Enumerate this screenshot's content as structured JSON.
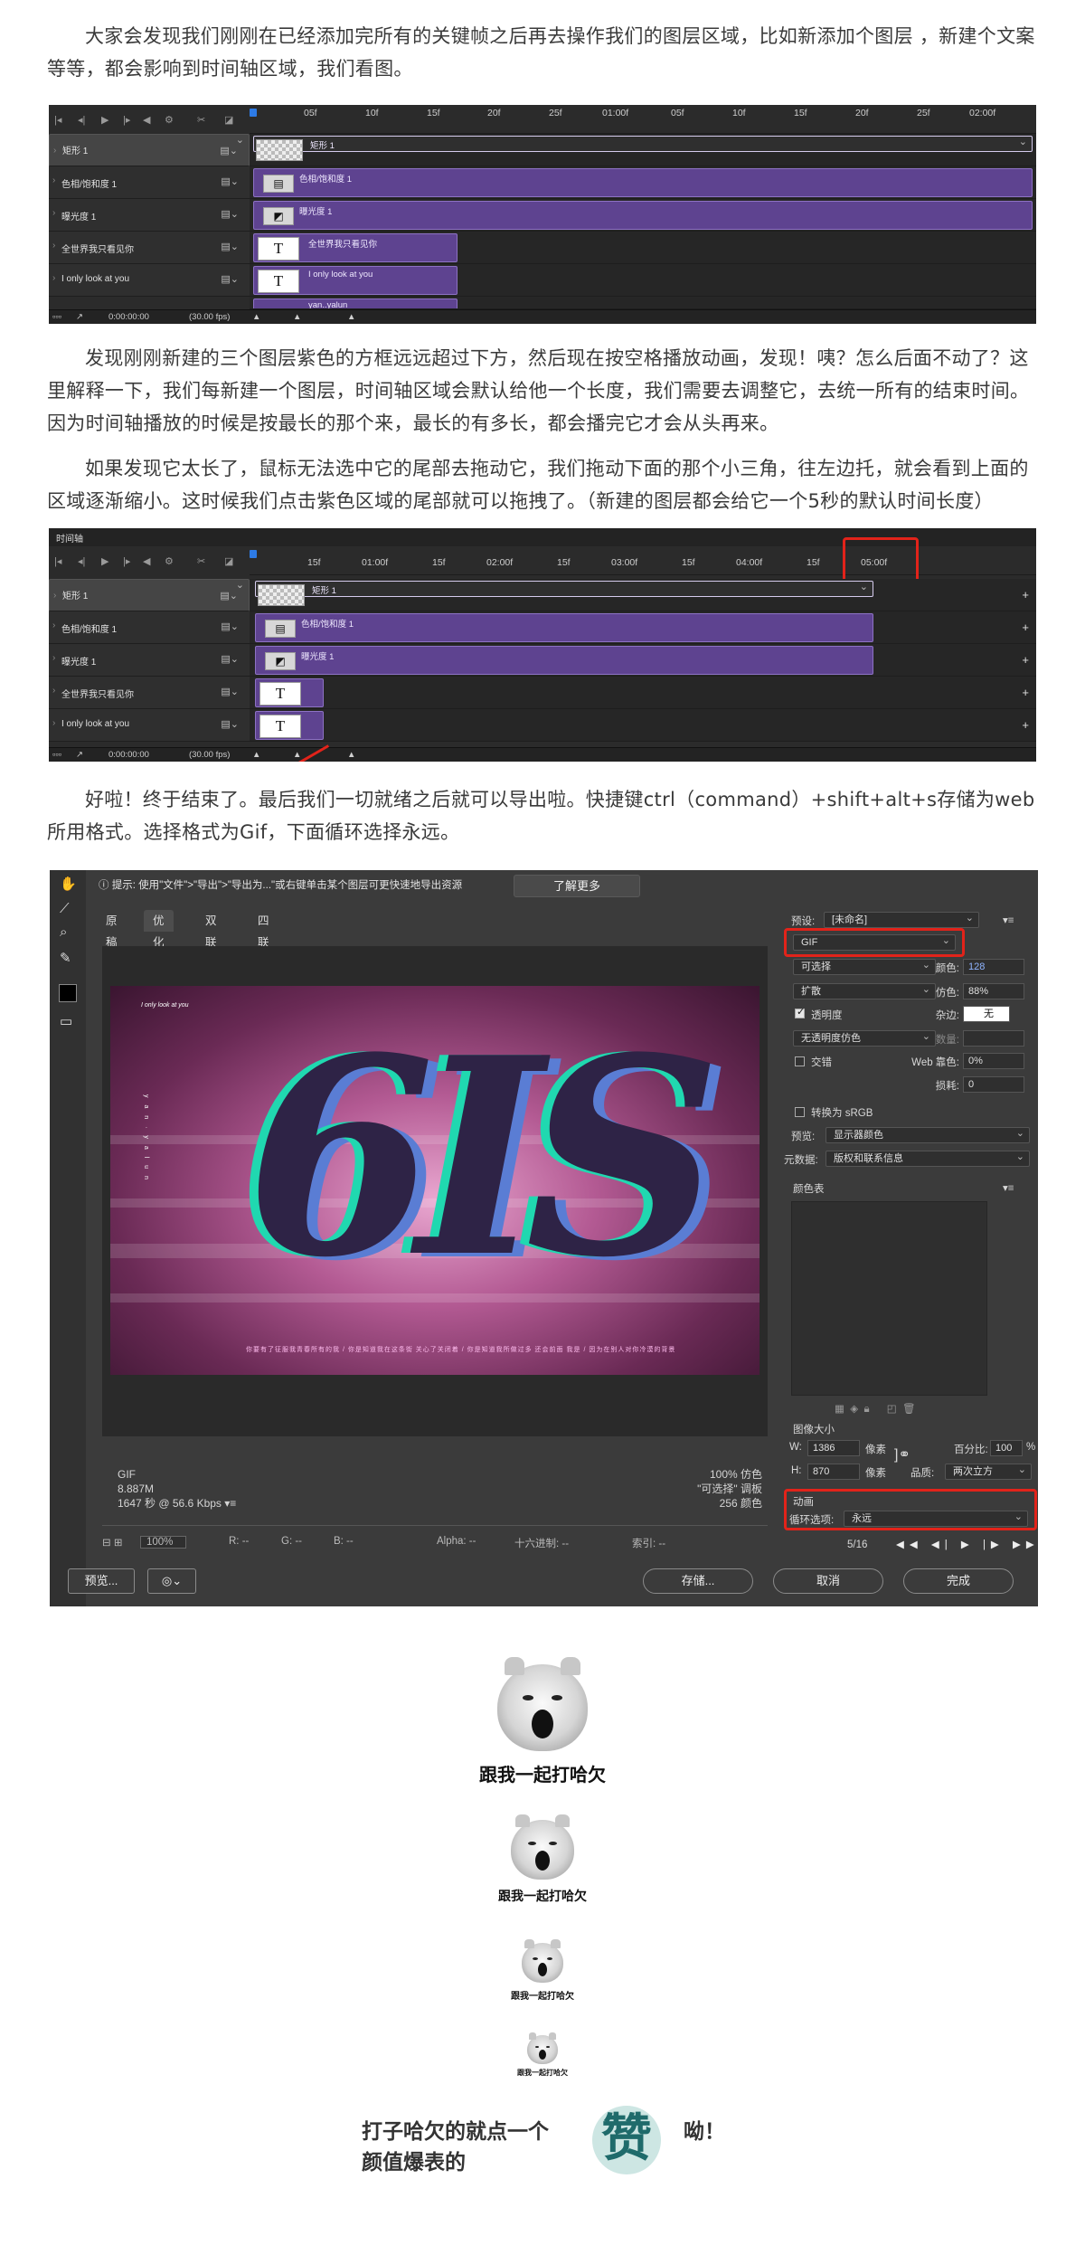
{
  "paragraphs": {
    "p1": "大家会发现我们刚刚在已经添加完所有的关键帧之后再去操作我们的图层区域，比如新添加个图层 ，新建个文案等等，都会影响到时间轴区域，我们看图。",
    "p2": "发现刚刚新建的三个图层紫色的方框远远超过下方，然后现在按空格播放动画，发现！咦？怎么后面不动了？这里解释一下，我们每新建一个图层，时间轴区域会默认给他一个长度，我们需要去调整它，去统一所有的结束时间。因为时间轴播放的时候是按最长的那个来，最长的有多长，都会播完它才会从头再来。",
    "p3": "如果发现它太长了，鼠标无法选中它的尾部去拖动它，我们拖动下面的那个小三角，往左边托，就会看到上面的区域逐渐缩小。这时候我们点击紫色区域的尾部就可以拖拽了。（新建的图层都会给它一个5秒的默认时间长度）",
    "p4": "好啦！终于结束了。最后我们一切就绪之后就可以导出啦。快捷键ctrl（command）+shift+alt+s存储为web所用格式。选择格式为Gif，下面循环选择永远。"
  },
  "timeline1": {
    "ticks": [
      "05f",
      "10f",
      "15f",
      "20f",
      "25f",
      "01:00f",
      "05f",
      "10f",
      "15f",
      "20f",
      "25f",
      "02:00f"
    ],
    "layers": [
      {
        "name": "矩形 1",
        "bar_label": "矩形 1"
      },
      {
        "name": "色相/饱和度 1",
        "bar_label": "色相/饱和度 1"
      },
      {
        "name": "曝光度 1",
        "bar_label": "曝光度 1"
      },
      {
        "name": "全世界我只看见你",
        "bar_label": "全世界我只看见你",
        "thumb": "T"
      },
      {
        "name": "I only look at you",
        "bar_label": "I only look at you",
        "thumb": "T"
      }
    ],
    "extra_bar_label": "yan..yalun",
    "timecode": "0:00:00:00",
    "fps": "(30.00 fps)"
  },
  "timeline2": {
    "panel_title": "时间轴",
    "ticks": [
      "15f",
      "01:00f",
      "15f",
      "02:00f",
      "15f",
      "03:00f",
      "15f",
      "04:00f",
      "15f",
      "05:00f"
    ],
    "layers": [
      {
        "name": "矩形 1",
        "bar_label": "矩形 1"
      },
      {
        "name": "色相/饱和度 1",
        "bar_label": "色相/饱和度 1"
      },
      {
        "name": "曝光度 1",
        "bar_label": "曝光度 1"
      },
      {
        "name": "全世界我只看见你",
        "thumb": "T"
      },
      {
        "name": "I only look at you",
        "thumb": "T"
      }
    ],
    "timecode": "0:00:00:00",
    "fps": "(30.00 fps)"
  },
  "dialog": {
    "tip": "提示: 使用\"文件\">\"导出\">\"导出为...\"或右键单击某个图层可更快速地导出资源",
    "learn_more": "了解更多",
    "tabs": [
      "原稿",
      "优化",
      "双联",
      "四联"
    ],
    "art_small_text": "I only look at you",
    "art_vertical_text": "y a n · y a l u n",
    "art_caption": "你要有了征服我青春所有的我 / 你是知道我在这条街 关心了关闭着 / 你是知道我所做过多 还会前面 我是 / 因为在别人对你冷漠的背景",
    "art_glyph": "6IS",
    "info_left": [
      "GIF",
      "8.887M",
      "1647 秒 @ 56.6 Kbps"
    ],
    "info_right": [
      "100% 仿色",
      "\"可选择\" 调板",
      "256 颜色"
    ],
    "status": {
      "zoom": "100%",
      "r": "R: --",
      "g": "G: --",
      "b": "B: --",
      "alpha": "Alpha: --",
      "hex": "十六进制: --",
      "index": "索引: --"
    },
    "buttons": {
      "preview": "预览...",
      "save": "存储...",
      "cancel": "取消",
      "done": "完成"
    },
    "panel": {
      "preset_label": "预设:",
      "preset_value": "[未命名]",
      "format": "GIF",
      "reduction": "可选择",
      "colors_label": "颜色:",
      "colors_value": "128",
      "dither_algo": "扩散",
      "dither_label": "仿色:",
      "dither_value": "88%",
      "transparency": "透明度",
      "matte_label": "杂边:",
      "matte_value": "无",
      "trans_dither": "无透明度仿色",
      "amount_label": "数量:",
      "interlaced": "交错",
      "web_snap_label": "Web 靠色:",
      "web_snap_value": "0%",
      "lossy_label": "损耗:",
      "lossy_value": "0",
      "srgb": "转换为 sRGB",
      "preview_label": "预览:",
      "preview_value": "显示器颜色",
      "metadata_label": "元数据:",
      "metadata_value": "版权和联系信息",
      "color_table": "颜色表",
      "image_size": "图像大小",
      "w_label": "W:",
      "w_value": "1386",
      "h_label": "H:",
      "h_value": "870",
      "unit": "像素",
      "percent_label": "百分比:",
      "percent_value": "100",
      "percent_unit": "%",
      "quality_label": "品质:",
      "quality_value": "两次立方",
      "animation": "动画",
      "loop_label": "循环选项:",
      "loop_value": "永远",
      "frame_counter": "5/16"
    }
  },
  "memes": {
    "caption": "跟我一起打哈欠"
  },
  "ending": {
    "line1a": "打子哈欠的就点一个",
    "zan": "赞",
    "line1b": "呦！",
    "line2": "颜值爆表的"
  },
  "colors": {
    "purple_bar": "#5e4390",
    "red_highlight": "#e2231a",
    "dialog_bg": "#3b3b3b",
    "teal": "#1f6b6b"
  }
}
